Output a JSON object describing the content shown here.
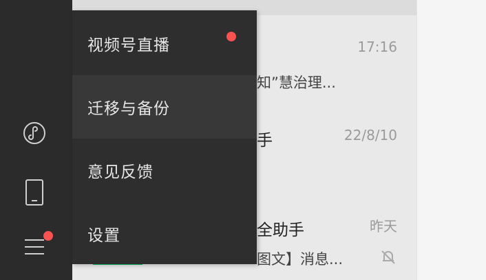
{
  "colors": {
    "sidebar_bg": "#2b2b2b",
    "menu_bg": "#2e2e2e",
    "menu_highlight": "#383838",
    "badge_red": "#fa5151",
    "accent_green": "#07c160"
  },
  "sidebar": {
    "icons": [
      {
        "name": "mini-program-icon"
      },
      {
        "name": "phone-icon"
      },
      {
        "name": "menu-icon",
        "has_badge": true
      }
    ]
  },
  "menu": {
    "items": [
      {
        "label": "视频号直播",
        "has_badge": true
      },
      {
        "label": "迁移与备份",
        "highlighted": true
      },
      {
        "label": "意见反馈"
      },
      {
        "label": "设置"
      }
    ]
  },
  "chats": [
    {
      "time": "17:16",
      "preview": "知”慧治理..."
    },
    {
      "name": "手",
      "time": "22/8/10"
    },
    {
      "name": "全助手",
      "time": "昨天",
      "preview": "图文】消息...",
      "muted": true
    }
  ]
}
